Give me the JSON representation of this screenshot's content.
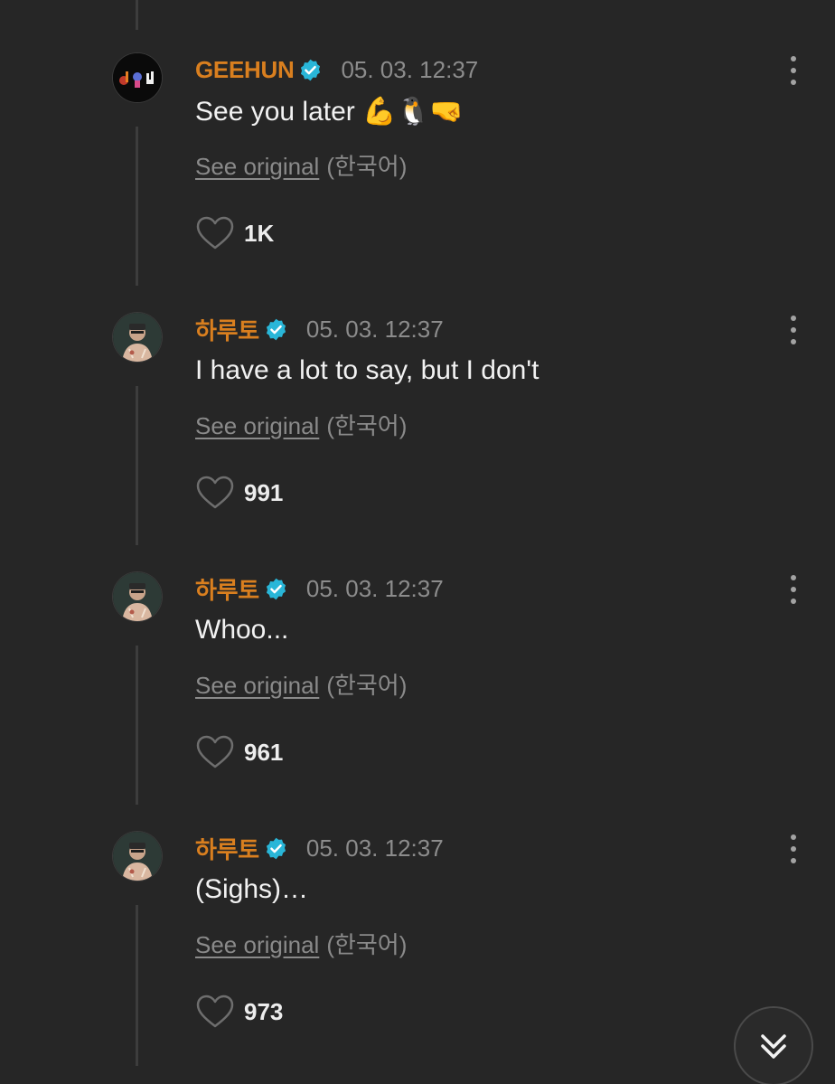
{
  "comments": [
    {
      "author": "GEEHUN",
      "verified": true,
      "timestamp": "05. 03. 12:37",
      "text": "See you later 💪🐧🤜",
      "see_original": "See original",
      "language": "(한국어)",
      "likes": "1K",
      "avatar_icon": "geehun-avatar-icon"
    },
    {
      "author": "하루토",
      "verified": true,
      "timestamp": "05. 03. 12:37",
      "text": "I have a lot to say, but I don't",
      "see_original": "See original",
      "language": "(한국어)",
      "likes": "991",
      "avatar_icon": "haruto-avatar-icon"
    },
    {
      "author": "하루토",
      "verified": true,
      "timestamp": "05. 03. 12:37",
      "text": "Whoo...",
      "see_original": "See original",
      "language": "(한국어)",
      "likes": "961",
      "avatar_icon": "haruto-avatar-icon"
    },
    {
      "author": "하루토",
      "verified": true,
      "timestamp": "05. 03. 12:37",
      "text": "(Sighs)…",
      "see_original": "See original",
      "language": "(한국어)",
      "likes": "973",
      "avatar_icon": "haruto-avatar-icon"
    }
  ],
  "colors": {
    "background": "#262626",
    "author": "#d97f1f",
    "verified_badge": "#29b6d8",
    "timestamp": "#8c8c8c",
    "body_text": "#f2f2f2"
  },
  "icons": {
    "verified": "verified-badge-icon",
    "more": "more-vertical-icon",
    "like": "heart-outline-icon",
    "scroll": "chevron-double-down-icon"
  }
}
